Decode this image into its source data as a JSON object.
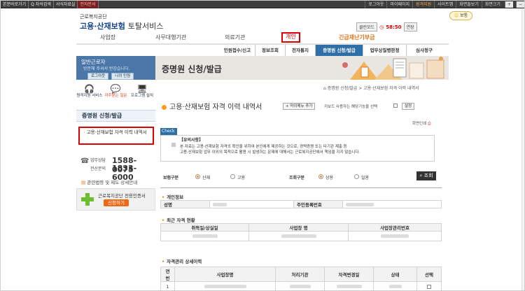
{
  "topbar": {
    "left": [
      "본문바로가기",
      "Q 자석검색",
      "서식자료실",
      "전자문서"
    ],
    "right": [
      "로그아웃",
      "마이페이지",
      "원격지원",
      "사이트맵",
      "화면돌보기"
    ],
    "zoom_label": "화면크기"
  },
  "header": {
    "org": "근로복지공단",
    "service_main": "고용·산재보험",
    "service_sub": "토탈서비스",
    "clean_mode": "클린모드",
    "timer": "58:50",
    "extend": "연장",
    "mode_btn": "보통"
  },
  "gnb": [
    "사업장",
    "사무대행기관",
    "의료기관",
    "개인",
    "긴급재난기부금"
  ],
  "subnav": [
    "민원접수/신고",
    "정보조회",
    "전자통지",
    "증명원 신청/발급",
    "업무상질병판정",
    "심사청구"
  ],
  "sidebar": {
    "greeting": "일반근로자",
    "greeting_sub": "방문해 주셔서 반갑습니다.",
    "logout": "로그아웃",
    "myinfo": "나의 민원",
    "icons": [
      {
        "label": "원격지원 서비스",
        "icon": "headset-icon"
      },
      {
        "label": "자주묻는 질문",
        "icon": "chat-icon"
      },
      {
        "label": "프로그램 설치",
        "icon": "monitor-icon"
      }
    ],
    "menu_title": "증명원 신청/발급",
    "menu_item": "고용·산재보험 자격 이력 내역서",
    "consult_label": "업무상담",
    "consult_num": "1588-0075",
    "phone_label": "전산문의",
    "phone_num": "1833-6000",
    "law": "관련법령 및 제도 상세안내",
    "cert_title": "근로복지공단 전용인증서",
    "cert_btn": "신청하기"
  },
  "banner": {
    "title": "증명원 신청/발급"
  },
  "breadcrumb": "증명원 신청/발급 > 고용·산재보험 자격 이력 내역서",
  "content": {
    "title": "고용·산재보험 자격 이력 내역서",
    "add_menu": "+ 마이메뉴 추가",
    "keyboard_note": "키보드 사용자는 해당기능을 선택",
    "setting": "설정",
    "print": "화면인쇄",
    "check_tag": "Check",
    "notice_head": "【유의사항】",
    "notice1": "본 자료는 고용·산재보험 자격의 확인을 위하여 본인에게 제공하는 것으로, 경력증명 또는 타기관 제출 등",
    "notice2": "고용·산재보험 업무 이외의 목적으로 활용 시 발생하는 문제에 대해서는 근로복지공단에서 책임을 지지 않습니다."
  },
  "search": {
    "ins_label": "보험구분",
    "ins_opts": [
      "산재",
      "고용"
    ],
    "query_label": "조회구분",
    "query_opts": [
      "상용",
      "일용"
    ],
    "go": "조회"
  },
  "personal": {
    "section": "개인정보",
    "name_h": "성명",
    "rrn_h": "주민등록번호"
  },
  "current": {
    "section": "최근 자격 현황",
    "headers": [
      "취득일/상실일",
      "사업장 명",
      "사업장관리번호"
    ]
  },
  "history": {
    "section": "자격관리 상세이력",
    "headers": [
      "연번",
      "사업장명",
      "처리기관",
      "자격변경일",
      "상태",
      "선택"
    ],
    "rows": [
      {
        "no": "1"
      }
    ]
  }
}
